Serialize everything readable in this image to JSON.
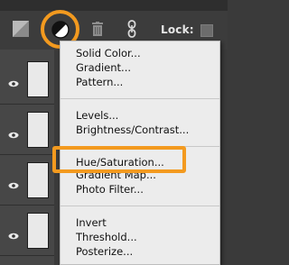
{
  "toolbar": {
    "lock_label": "Lock:",
    "icons": [
      "layer-fill-icon",
      "adjustment-layer-icon",
      "trash-icon",
      "link-icon"
    ]
  },
  "menu": {
    "groups": [
      [
        {
          "label": "Solid Color..."
        },
        {
          "label": "Gradient..."
        },
        {
          "label": "Pattern..."
        }
      ],
      [
        {
          "label": "Levels..."
        },
        {
          "label": "Brightness/Contrast..."
        }
      ],
      [
        {
          "label": "Hue/Saturation..."
        },
        {
          "label": "Gradient Map..."
        },
        {
          "label": "Photo Filter..."
        }
      ],
      [
        {
          "label": "Invert"
        },
        {
          "label": "Threshold..."
        },
        {
          "label": "Posterize..."
        }
      ]
    ]
  },
  "highlight_color": "#f39a1f"
}
